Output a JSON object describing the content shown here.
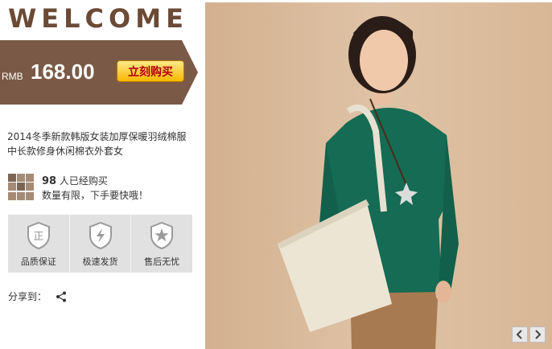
{
  "header": {
    "welcome": "WELCOME"
  },
  "price": {
    "currency": "RMB",
    "amount": "168.00",
    "buy_label": "立刻购买"
  },
  "product": {
    "title_line1": "2014冬季新款韩版女装加厚保暖羽绒棉服",
    "title_line2": "中长款修身休闲棉衣外套女"
  },
  "sold": {
    "count": "98",
    "count_suffix": "人已经购买",
    "note": "数量有限，下手要快哦！"
  },
  "guarantees": [
    {
      "label": "品质保证",
      "icon_glyph": "正",
      "icon": "shield-authentic-icon"
    },
    {
      "label": "极速发货",
      "icon_glyph": "⚡",
      "icon": "shield-lightning-icon"
    },
    {
      "label": "售后无忧",
      "icon_glyph": "★",
      "icon": "shield-star-icon"
    }
  ],
  "share": {
    "label": "分享到："
  },
  "colors": {
    "brown": "#6b4a36",
    "banner": "#7a5a46",
    "button": "#f7b800",
    "green_top": "#156b54"
  }
}
